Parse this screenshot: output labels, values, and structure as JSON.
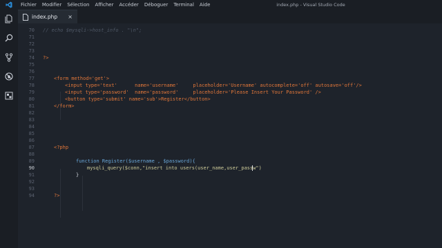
{
  "window": {
    "title": "index.php - Visual Studio Code",
    "menu": [
      "Fichier",
      "Modifier",
      "Sélection",
      "Afficher",
      "Accéder",
      "Déboguer",
      "Terminal",
      "Aide"
    ]
  },
  "activity_icons": [
    "explorer-icon",
    "search-icon",
    "source-control-icon",
    "debug-icon",
    "extensions-icon"
  ],
  "tab": {
    "filename": "index.php",
    "close": "×"
  },
  "colors": {
    "background": "#1e232b",
    "accent": "#2a8ad4",
    "tag": "#e2773a",
    "string": "#cfcc9a",
    "function": "#6aa7d8"
  },
  "code": {
    "cursor_line": 90,
    "lines": [
      {
        "n": "70",
        "t": "// echo $mysqli->host_info . \"\\n\";"
      },
      {
        "n": "71",
        "t": ""
      },
      {
        "n": "72",
        "t": ""
      },
      {
        "n": "73",
        "t": ""
      },
      {
        "n": "74",
        "t": "?>"
      },
      {
        "n": "75",
        "t": ""
      },
      {
        "n": "76",
        "t": ""
      },
      {
        "n": "77",
        "t": "<form method='get'>"
      },
      {
        "n": "78",
        "t": "<input type='text'      name='username'     placeholder='Username' autocomplete='off' autosave='off'/>"
      },
      {
        "n": "79",
        "t": "<input type='password'  name='password'     placeholder='Please Insert Your Password' />"
      },
      {
        "n": "80",
        "t": "<button type='submit' name='sub'>Register</button>"
      },
      {
        "n": "81",
        "t": "</form>"
      },
      {
        "n": "82",
        "t": ""
      },
      {
        "n": "83",
        "t": ""
      },
      {
        "n": "84",
        "t": ""
      },
      {
        "n": "85",
        "t": ""
      },
      {
        "n": "86",
        "t": ""
      },
      {
        "n": "87",
        "t": "<?php"
      },
      {
        "n": "88",
        "t": ""
      },
      {
        "n": "89",
        "t": "function Register($username , $password){"
      },
      {
        "n": "90",
        "t": "mysqli_query($conn,\"insert into users(user_name,user_passw\")"
      },
      {
        "n": "91",
        "t": "}"
      },
      {
        "n": "92",
        "t": ""
      },
      {
        "n": "93",
        "t": ""
      },
      {
        "n": "94",
        "t": "?>"
      }
    ]
  }
}
